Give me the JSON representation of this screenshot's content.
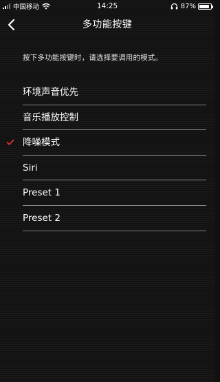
{
  "status_bar": {
    "carrier": "中国移动",
    "time": "14:25",
    "battery_percent": "87%",
    "battery_level": 0.87,
    "icons": [
      "signal-icon",
      "wifi-icon",
      "headphone-icon",
      "battery-icon"
    ]
  },
  "nav": {
    "back_icon": "chevron-left-icon",
    "title": "多功能按键"
  },
  "instruction": "按下多功能按键时，请选择要调用的模式。",
  "options": [
    {
      "label": "环境声音优先",
      "selected": false
    },
    {
      "label": "音乐播放控制",
      "selected": false
    },
    {
      "label": "降噪模式",
      "selected": true
    },
    {
      "label": "Siri",
      "selected": false
    },
    {
      "label": "Preset 1",
      "selected": false
    },
    {
      "label": "Preset 2",
      "selected": false
    }
  ],
  "colors": {
    "background": "#121212",
    "text": "#ffffff",
    "divider": "#8a8a8a",
    "check": "#e0302c"
  }
}
